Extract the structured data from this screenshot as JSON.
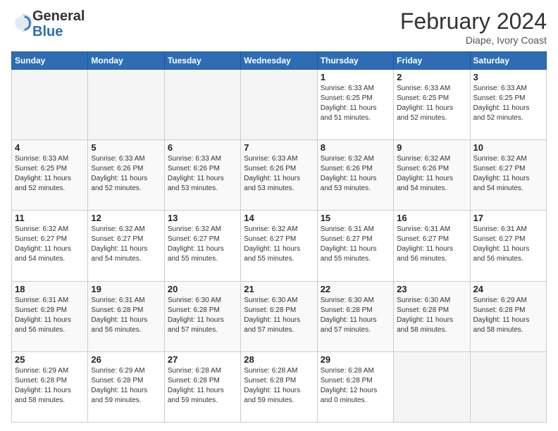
{
  "header": {
    "title": "February 2024",
    "location": "Diape, Ivory Coast",
    "logo_general": "General",
    "logo_blue": "Blue"
  },
  "days_of_week": [
    "Sunday",
    "Monday",
    "Tuesday",
    "Wednesday",
    "Thursday",
    "Friday",
    "Saturday"
  ],
  "weeks": [
    [
      {
        "day": "",
        "info": ""
      },
      {
        "day": "",
        "info": ""
      },
      {
        "day": "",
        "info": ""
      },
      {
        "day": "",
        "info": ""
      },
      {
        "day": "1",
        "info": "Sunrise: 6:33 AM\nSunset: 6:25 PM\nDaylight: 11 hours\nand 51 minutes."
      },
      {
        "day": "2",
        "info": "Sunrise: 6:33 AM\nSunset: 6:25 PM\nDaylight: 11 hours\nand 52 minutes."
      },
      {
        "day": "3",
        "info": "Sunrise: 6:33 AM\nSunset: 6:25 PM\nDaylight: 11 hours\nand 52 minutes."
      }
    ],
    [
      {
        "day": "4",
        "info": "Sunrise: 6:33 AM\nSunset: 6:25 PM\nDaylight: 11 hours\nand 52 minutes."
      },
      {
        "day": "5",
        "info": "Sunrise: 6:33 AM\nSunset: 6:26 PM\nDaylight: 11 hours\nand 52 minutes."
      },
      {
        "day": "6",
        "info": "Sunrise: 6:33 AM\nSunset: 6:26 PM\nDaylight: 11 hours\nand 53 minutes."
      },
      {
        "day": "7",
        "info": "Sunrise: 6:33 AM\nSunset: 6:26 PM\nDaylight: 11 hours\nand 53 minutes."
      },
      {
        "day": "8",
        "info": "Sunrise: 6:32 AM\nSunset: 6:26 PM\nDaylight: 11 hours\nand 53 minutes."
      },
      {
        "day": "9",
        "info": "Sunrise: 6:32 AM\nSunset: 6:26 PM\nDaylight: 11 hours\nand 54 minutes."
      },
      {
        "day": "10",
        "info": "Sunrise: 6:32 AM\nSunset: 6:27 PM\nDaylight: 11 hours\nand 54 minutes."
      }
    ],
    [
      {
        "day": "11",
        "info": "Sunrise: 6:32 AM\nSunset: 6:27 PM\nDaylight: 11 hours\nand 54 minutes."
      },
      {
        "day": "12",
        "info": "Sunrise: 6:32 AM\nSunset: 6:27 PM\nDaylight: 11 hours\nand 54 minutes."
      },
      {
        "day": "13",
        "info": "Sunrise: 6:32 AM\nSunset: 6:27 PM\nDaylight: 11 hours\nand 55 minutes."
      },
      {
        "day": "14",
        "info": "Sunrise: 6:32 AM\nSunset: 6:27 PM\nDaylight: 11 hours\nand 55 minutes."
      },
      {
        "day": "15",
        "info": "Sunrise: 6:31 AM\nSunset: 6:27 PM\nDaylight: 11 hours\nand 55 minutes."
      },
      {
        "day": "16",
        "info": "Sunrise: 6:31 AM\nSunset: 6:27 PM\nDaylight: 11 hours\nand 56 minutes."
      },
      {
        "day": "17",
        "info": "Sunrise: 6:31 AM\nSunset: 6:27 PM\nDaylight: 11 hours\nand 56 minutes."
      }
    ],
    [
      {
        "day": "18",
        "info": "Sunrise: 6:31 AM\nSunset: 6:28 PM\nDaylight: 11 hours\nand 56 minutes."
      },
      {
        "day": "19",
        "info": "Sunrise: 6:31 AM\nSunset: 6:28 PM\nDaylight: 11 hours\nand 56 minutes."
      },
      {
        "day": "20",
        "info": "Sunrise: 6:30 AM\nSunset: 6:28 PM\nDaylight: 11 hours\nand 57 minutes."
      },
      {
        "day": "21",
        "info": "Sunrise: 6:30 AM\nSunset: 6:28 PM\nDaylight: 11 hours\nand 57 minutes."
      },
      {
        "day": "22",
        "info": "Sunrise: 6:30 AM\nSunset: 6:28 PM\nDaylight: 11 hours\nand 57 minutes."
      },
      {
        "day": "23",
        "info": "Sunrise: 6:30 AM\nSunset: 6:28 PM\nDaylight: 11 hours\nand 58 minutes."
      },
      {
        "day": "24",
        "info": "Sunrise: 6:29 AM\nSunset: 6:28 PM\nDaylight: 11 hours\nand 58 minutes."
      }
    ],
    [
      {
        "day": "25",
        "info": "Sunrise: 6:29 AM\nSunset: 6:28 PM\nDaylight: 11 hours\nand 58 minutes."
      },
      {
        "day": "26",
        "info": "Sunrise: 6:29 AM\nSunset: 6:28 PM\nDaylight: 11 hours\nand 59 minutes."
      },
      {
        "day": "27",
        "info": "Sunrise: 6:28 AM\nSunset: 6:28 PM\nDaylight: 11 hours\nand 59 minutes."
      },
      {
        "day": "28",
        "info": "Sunrise: 6:28 AM\nSunset: 6:28 PM\nDaylight: 11 hours\nand 59 minutes."
      },
      {
        "day": "29",
        "info": "Sunrise: 6:28 AM\nSunset: 6:28 PM\nDaylight: 12 hours\nand 0 minutes."
      },
      {
        "day": "",
        "info": ""
      },
      {
        "day": "",
        "info": ""
      }
    ]
  ]
}
